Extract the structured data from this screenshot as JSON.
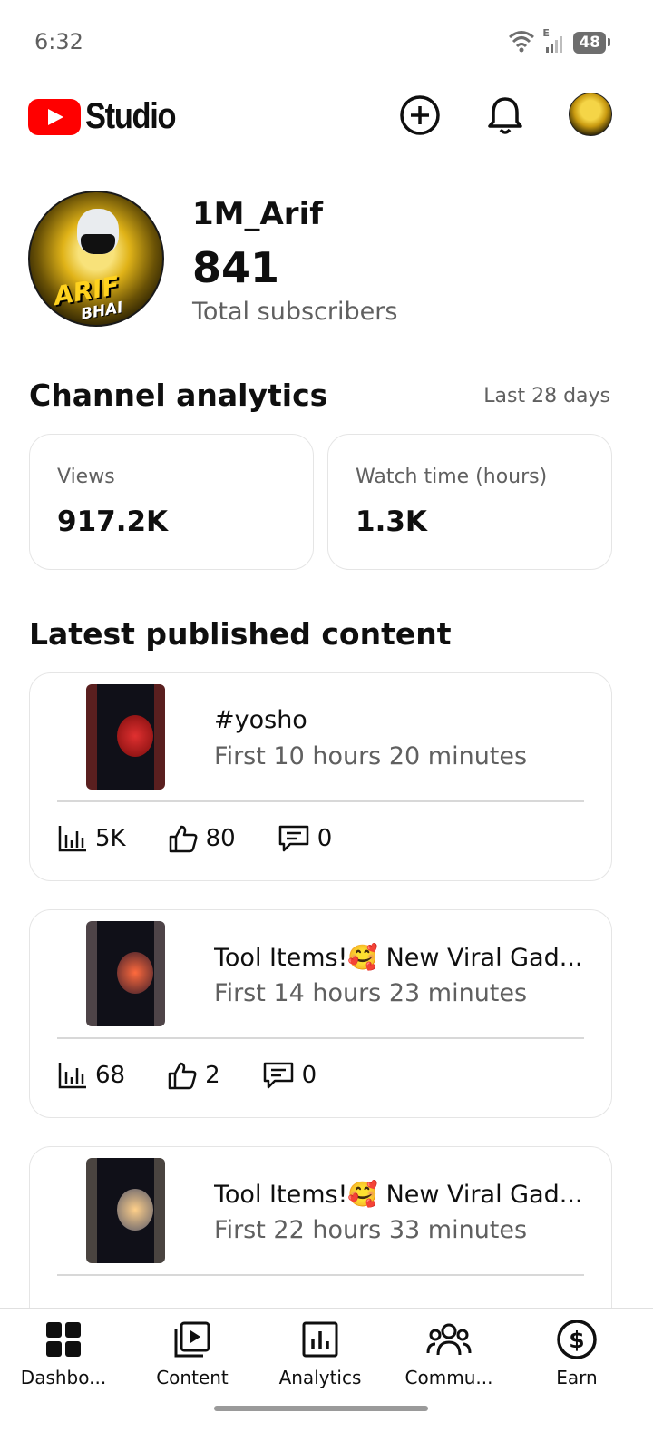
{
  "status_bar": {
    "time": "6:32",
    "network_label": "E",
    "battery": "48"
  },
  "header": {
    "logo_text": "Studio",
    "brand_color": "#ff0000",
    "create_icon": "plus-circle-icon",
    "notifications_icon": "bell-icon"
  },
  "profile": {
    "channel_name": "1M_Arif",
    "avatar_text_main": "ARIF",
    "avatar_text_sub": "BHAI",
    "subscriber_count": "841",
    "subscriber_label": "Total subscribers"
  },
  "analytics": {
    "title": "Channel analytics",
    "range": "Last 28 days",
    "cards": [
      {
        "label": "Views",
        "value": "917.2K"
      },
      {
        "label": "Watch time (hours)",
        "value": "1.3K"
      }
    ]
  },
  "latest": {
    "title": "Latest published content",
    "items": [
      {
        "title": "#yosho",
        "subtitle": "First 10 hours 20 minutes",
        "views": "5K",
        "likes": "80",
        "comments": "0",
        "thumb_color": "#5a1f1f"
      },
      {
        "title": "Tool Items!🥰 New Viral Gad...",
        "subtitle": "First 14 hours 23 minutes",
        "views": "68",
        "likes": "2",
        "comments": "0",
        "thumb_color": "#4e4448"
      },
      {
        "title": "Tool Items!🥰 New Viral Gad...",
        "subtitle": "First 22 hours 33 minutes",
        "views": "",
        "likes": "",
        "comments": "",
        "thumb_color": "#4a4440"
      }
    ]
  },
  "bottom_nav": {
    "items": [
      {
        "label": "Dashbo...",
        "icon": "dashboard-icon"
      },
      {
        "label": "Content",
        "icon": "video-library-icon"
      },
      {
        "label": "Analytics",
        "icon": "analytics-chart-icon"
      },
      {
        "label": "Commu...",
        "icon": "community-people-icon"
      },
      {
        "label": "Earn",
        "icon": "dollar-circle-icon"
      }
    ]
  }
}
